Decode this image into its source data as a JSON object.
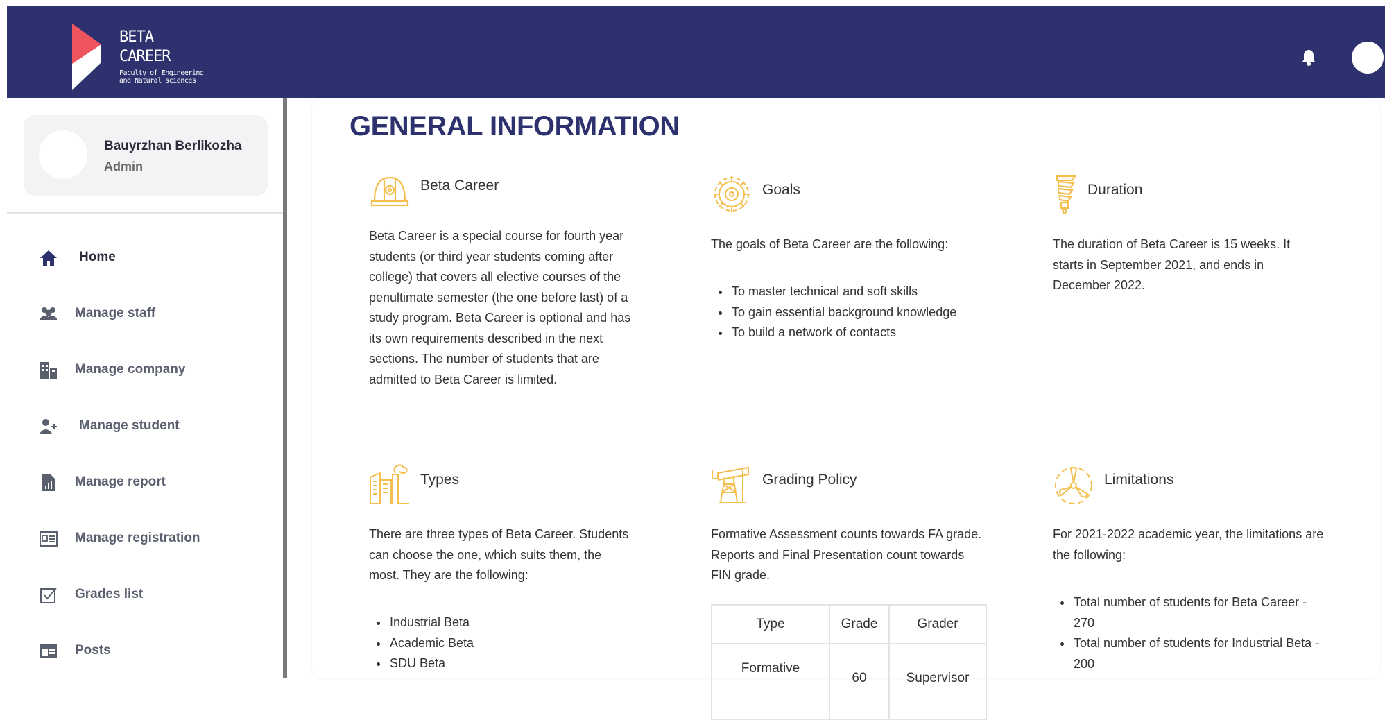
{
  "header": {
    "brand_line1": "BETA",
    "brand_line2": "CAREER",
    "brand_sub1": "Faculty of Engineering",
    "brand_sub2": "and Natural sciences",
    "bg_color": "#2d316e",
    "accent_color": "#f0545d"
  },
  "profile": {
    "name": "Bauyrzhan Berlikozha",
    "role": "Admin"
  },
  "sidebar": {
    "items": [
      {
        "label": "Home",
        "icon": "home-icon",
        "active": true
      },
      {
        "label": "Manage staff",
        "icon": "users-icon"
      },
      {
        "label": "Manage company",
        "icon": "building-icon"
      },
      {
        "label": "Manage student",
        "icon": "user-plus-icon"
      },
      {
        "label": "Manage report",
        "icon": "report-icon"
      },
      {
        "label": "Manage registration",
        "icon": "registration-icon"
      },
      {
        "label": "Grades list",
        "icon": "checkbox-icon"
      },
      {
        "label": "Posts",
        "icon": "posts-icon"
      }
    ]
  },
  "main": {
    "title": "GENERAL INFORMATION",
    "icon_color": "#f5bf4f",
    "sections": {
      "beta_career": {
        "title": "Beta Career",
        "icon": "helmet-icon",
        "body": "Beta Career is a special course for fourth year students (or third year students coming after college) that covers all elective courses of the penultimate semester (the one before last) of a study program. Beta Career is optional and has its own requirements described in the next sections. The number of students that are admitted to Beta Career is limited."
      },
      "goals": {
        "title": "Goals",
        "icon": "gear-icon",
        "intro": "The goals of Beta Career are the following:",
        "items": [
          "To master technical and soft skills",
          "To gain essential background knowledge",
          "To build a network of contacts"
        ]
      },
      "duration": {
        "title": "Duration",
        "icon": "lightbulb-icon",
        "body": "The duration of Beta Career is 15 weeks. It starts in September 2021, and ends in December 2022."
      },
      "types": {
        "title": "Types",
        "icon": "factory-icon",
        "intro": "There are three types of Beta Career. Students can choose the one, which suits them, the most. They are the following:",
        "items": [
          "Industrial Beta",
          "Academic Beta",
          "SDU Beta"
        ]
      },
      "grading": {
        "title": "Grading Policy",
        "icon": "oil-pump-icon",
        "intro": "Formative Assessment counts towards FA grade. Reports and Final Presentation count towards FIN grade.",
        "table": {
          "headers": [
            "Type",
            "Grade",
            "Grader"
          ],
          "rows": [
            [
              "Formative",
              "60",
              "Supervisor"
            ]
          ]
        }
      },
      "limitations": {
        "title": "Limitations",
        "icon": "wind-turbine-icon",
        "intro": "For 2021-2022 academic year, the limitations are the following:",
        "items": [
          "Total number of students for Beta Career - 270",
          "Total number of students for Industrial Beta - 200"
        ]
      }
    }
  }
}
